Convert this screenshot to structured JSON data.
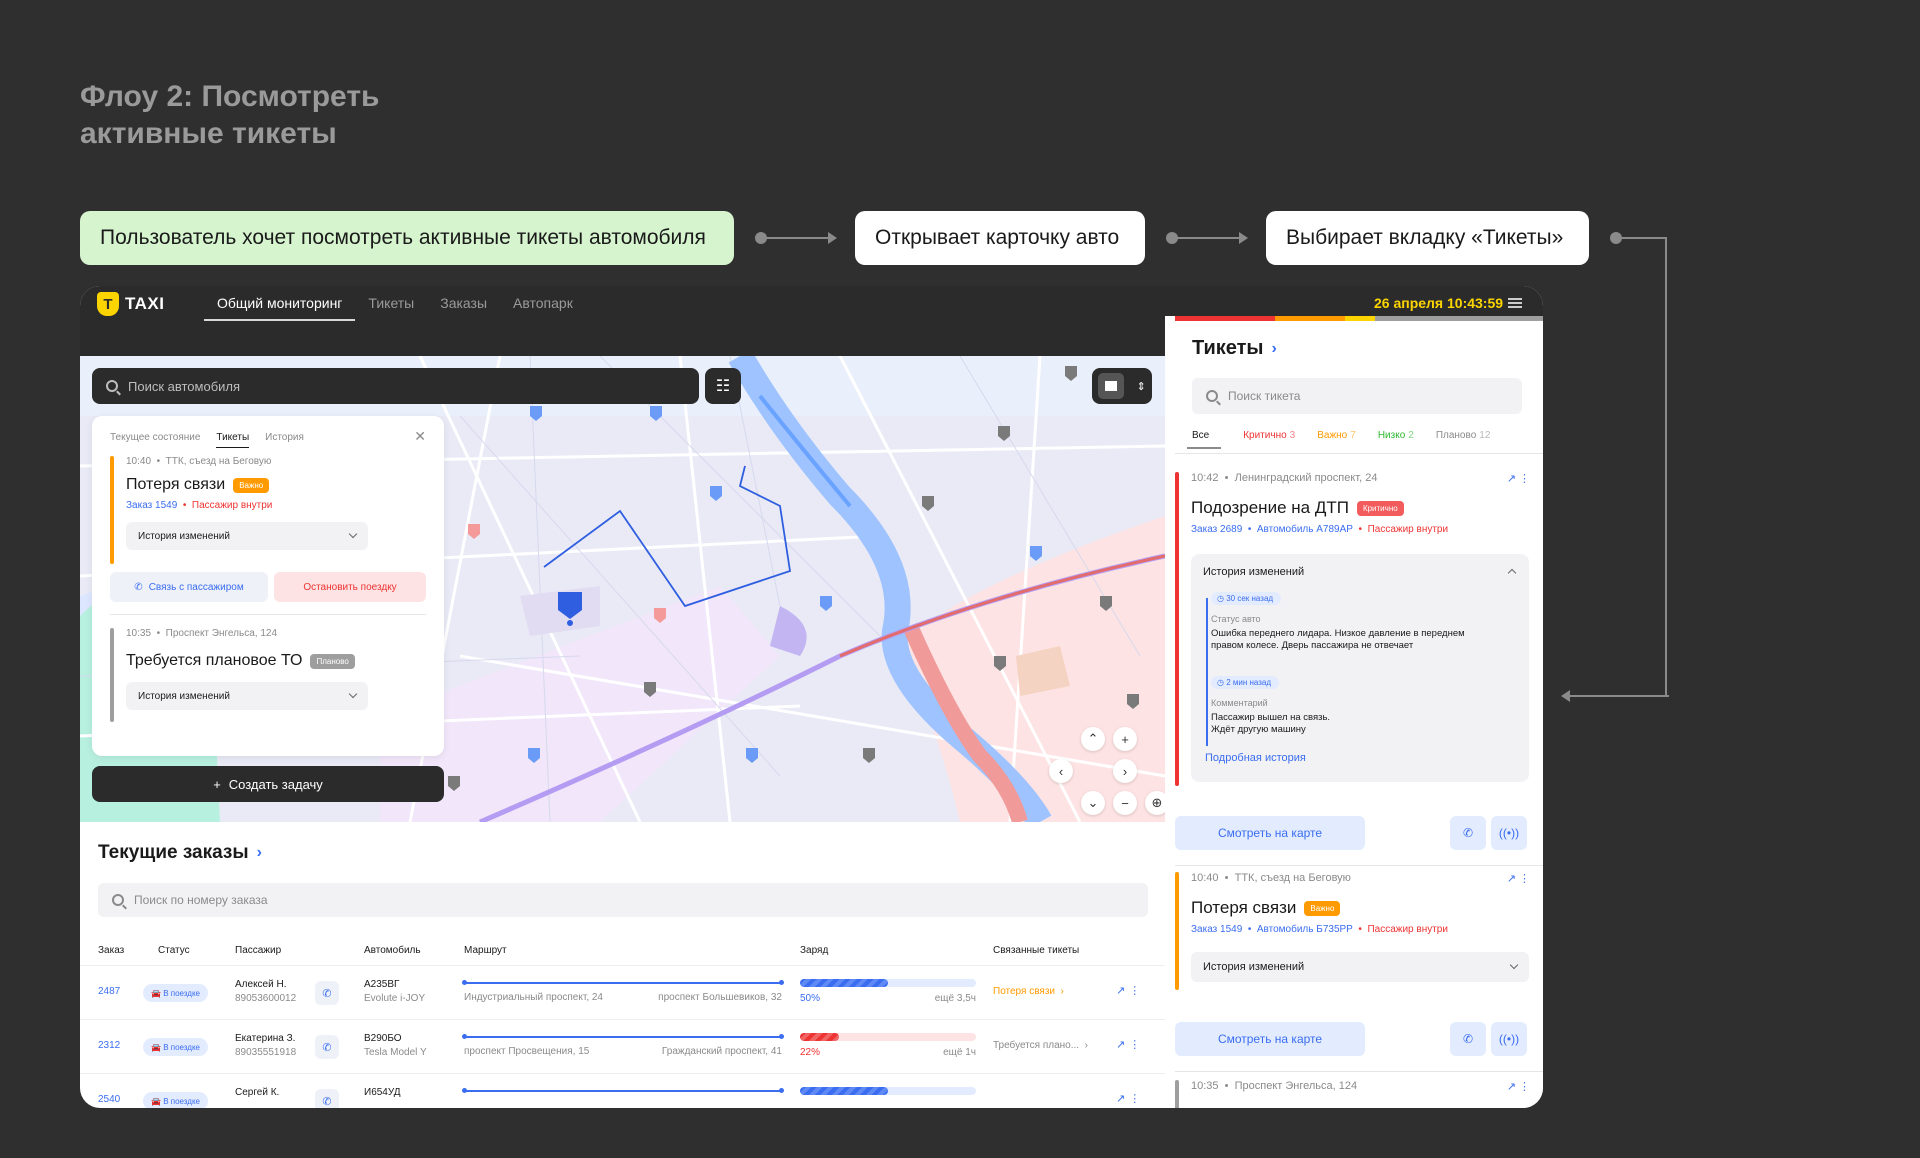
{
  "flow_title": "Флоу 2: Посмотреть активные тикеты",
  "steps": [
    "Пользователь хочет посмотреть активные тикеты автомобиля",
    "Открывает карточку авто",
    "Выбирает вкладку «Тикеты»"
  ],
  "app": {
    "logo_text": "TAXI",
    "logo_badge": "T",
    "nav": [
      "Общий мониторинг",
      "Тикеты",
      "Заказы",
      "Автопарк"
    ],
    "clock": "26 апреля 10:43:59"
  },
  "map": {
    "search_placeholder": "Поиск автомобиля",
    "create_task": "Создать задачу",
    "card": {
      "tabs": [
        "Текущее состояние",
        "Тикеты",
        "История"
      ],
      "tickets": [
        {
          "time": "10:40",
          "place": "ТТК, съезд на Беговую",
          "title": "Потеря связи",
          "badge": "Важно",
          "order": "Заказ 1549",
          "passenger": "Пассажир внутри",
          "history": "История изменений",
          "btn_call": "Связь с пассажиром",
          "btn_stop": "Остановить поездку"
        },
        {
          "time": "10:35",
          "place": "Проспект Энгельса, 124",
          "title": "Требуется плановое ТО",
          "badge": "Планово",
          "history": "История изменений"
        }
      ]
    }
  },
  "orders": {
    "title": "Текущие заказы",
    "search_placeholder": "Поиск по номеру заказа",
    "columns": [
      "Заказ",
      "Статус",
      "Пассажир",
      "Автомобиль",
      "Маршрут",
      "Заряд",
      "Связанные тикеты"
    ],
    "rows": [
      {
        "id": "2487",
        "status": "В поездке",
        "name": "Алексей Н.",
        "phone": "89053600012",
        "plate": "А235ВГ",
        "model": "Evolute i-JOY",
        "from": "Индустриальный проспект, 24",
        "to": "проспект Большевиков, 32",
        "charge_pct": 50,
        "charge": "50%",
        "remain": "ещё 3,5ч",
        "ticket": "Потеря связи",
        "ticket_color": "#ff9a00"
      },
      {
        "id": "2312",
        "status": "В поездке",
        "name": "Екатерина З.",
        "phone": "89035551918",
        "plate": "В290БО",
        "model": "Tesla Model Y",
        "from": "проспект Просвещения, 15",
        "to": "Гражданский проспект, 41",
        "charge_pct": 22,
        "charge": "22%",
        "remain": "ещё 1ч",
        "ticket": "Требуется плано...",
        "ticket_color": "#8a8a8a"
      },
      {
        "id": "2540",
        "status": "В поездке",
        "name": "Сергей К.",
        "phone": "",
        "plate": "И654УД",
        "model": "",
        "from": "",
        "to": "",
        "charge_pct": 50,
        "charge": "",
        "remain": "",
        "ticket": "",
        "ticket_color": "#8a8a8a"
      }
    ]
  },
  "side": {
    "title": "Тикеты",
    "search_placeholder": "Поиск тикета",
    "tabs": [
      {
        "label": "Все",
        "count": ""
      },
      {
        "label": "Критично",
        "count": "3",
        "color": "#e33"
      },
      {
        "label": "Важно",
        "count": "7",
        "color": "#ff9a00"
      },
      {
        "label": "Низко",
        "count": "2",
        "color": "#2eb82e"
      },
      {
        "label": "Планово",
        "count": "12",
        "color": "#8a8a8a"
      }
    ],
    "tickets": [
      {
        "time": "10:42",
        "place": "Ленинградский проспект, 24",
        "title": "Подозрение на ДТП",
        "badge": "Критично",
        "order": "Заказ 2689",
        "car": "Автомобиль А789АР",
        "passenger": "Пассажир внутри",
        "history_title": "История изменений",
        "events": [
          {
            "ago": "30 сек назад",
            "label": "Статус авто",
            "text1": "Ошибка переднего лидара. Низкое давление в переднем",
            "text2": "правом колесе. Дверь пассажира не отвечает"
          },
          {
            "ago": "2 мин назад",
            "label": "Комментарий",
            "text1": "Пассажир вышел на связь.",
            "text2": "Ждёт другую машину"
          }
        ],
        "more": "Подробная история",
        "map_btn": "Смотреть на карте"
      },
      {
        "time": "10:40",
        "place": "ТТК, съезд на Беговую",
        "title": "Потеря связи",
        "badge": "Важно",
        "order": "Заказ 1549",
        "car": "Автомобиль Б735РР",
        "passenger": "Пассажир внутри",
        "history_title": "История изменений",
        "map_btn": "Смотреть на карте"
      },
      {
        "time": "10:35",
        "place": "Проспект Энгельса, 124"
      }
    ]
  },
  "icons": {
    "search": "search-icon",
    "filter": "filter-icon",
    "phone": "phone-icon",
    "signal": "signal-icon",
    "external": "external-link-icon",
    "more": "more-icon",
    "car": "car-icon",
    "plus": "plus-icon",
    "chevron": "chevron-down-icon"
  },
  "colors": {
    "critical": "#e33",
    "important": "#ff9a00",
    "low": "#2eb82e",
    "planned": "#9e9e9e",
    "accent": "#3a6df0",
    "brand": "#fcd500"
  }
}
